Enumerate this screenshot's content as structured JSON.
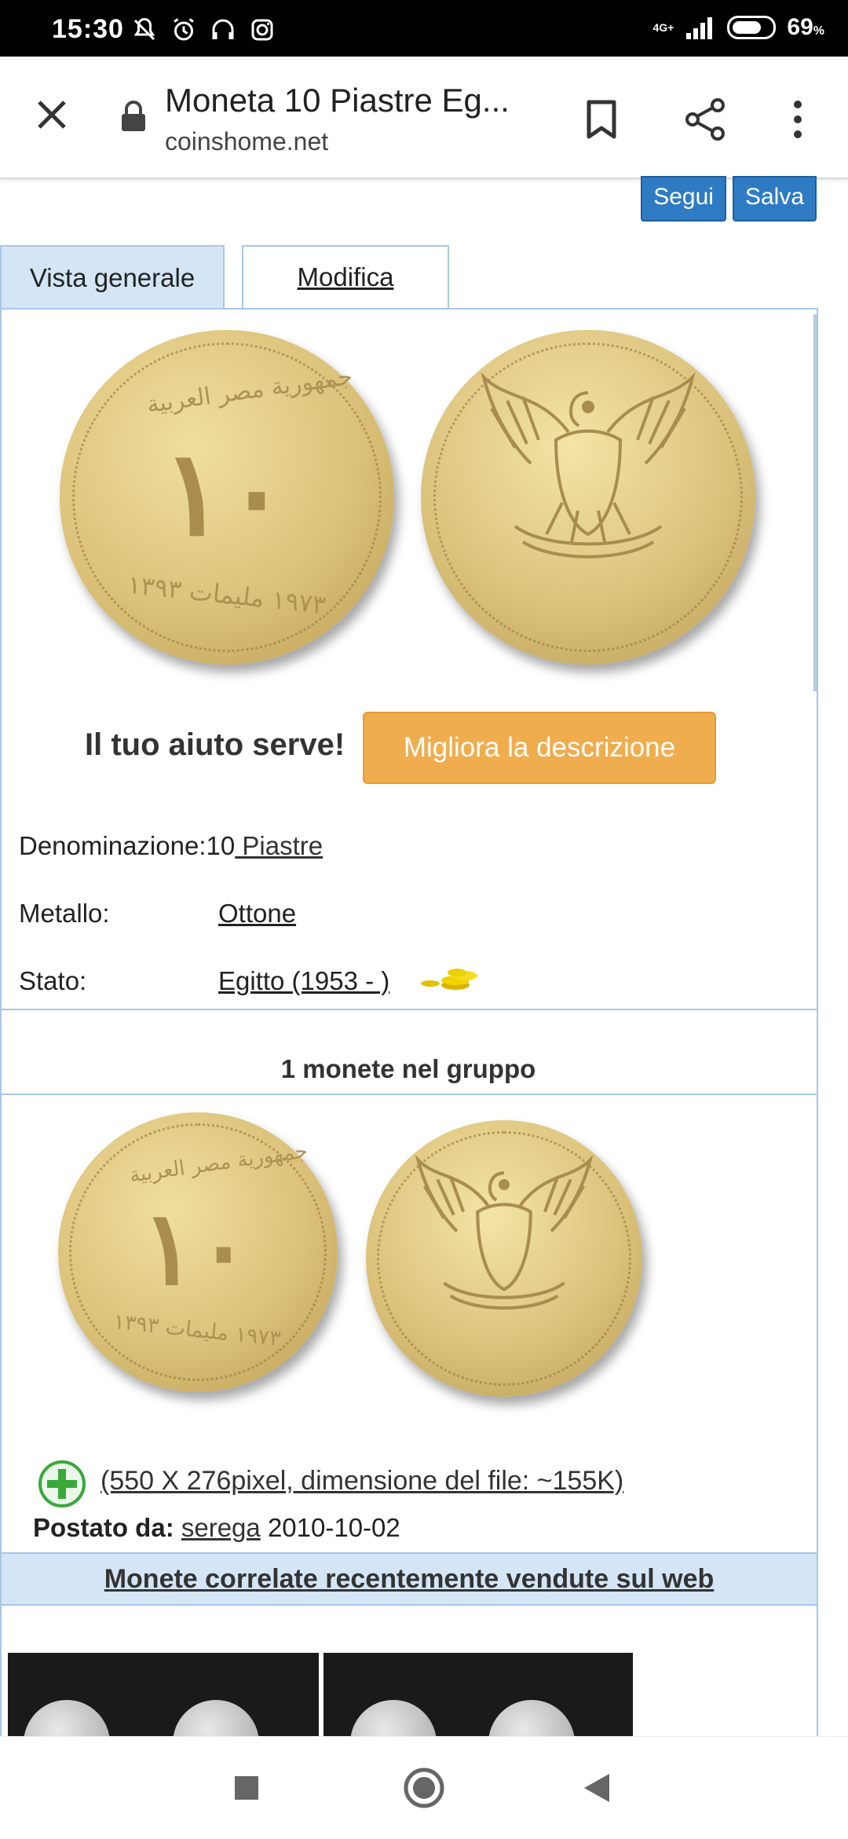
{
  "status_bar": {
    "time": "15:30",
    "network": "4G+",
    "battery": "69",
    "battery_unit": "%",
    "icons": [
      "mute-bell-icon",
      "alarm-icon",
      "headphones-icon",
      "instagram-icon",
      "signal-icon",
      "battery-icon"
    ]
  },
  "browser": {
    "page_title": "Moneta 10 Piastre Eg...",
    "host": "coinshome.net",
    "icons": [
      "close-icon",
      "lock-icon",
      "bookmark-icon",
      "share-icon",
      "more-vert-icon"
    ]
  },
  "actions": {
    "follow": "Segui",
    "save": "Salva"
  },
  "tabs": [
    {
      "label": "Vista generale",
      "active": true
    },
    {
      "label": "Modifica",
      "active": false
    }
  ],
  "coin_main": {
    "obverse_numeral": "١٠",
    "obverse_text_top": "جمهورية مصر العربية",
    "obverse_text_bottom": "١٩٧٣ مليمات ١٣٩٣"
  },
  "help": {
    "text": "Il tuo aiuto serve!",
    "button": "Migliora la descrizione"
  },
  "info": {
    "denomination_label": "Denominazione:",
    "denomination_value": "10",
    "denomination_link": " Piastre",
    "metal_label": "Metallo:",
    "metal_value": "Ottone",
    "state_label": "Stato:",
    "state_value": "Egitto (1953 - )"
  },
  "group": {
    "title": "1 monete nel gruppo",
    "file_info": "(550 X 276pixel, dimensione del file: ~155K)",
    "posted_label": "Postato da:",
    "posted_user": "serega",
    "posted_date": "2010-10-02"
  },
  "related": {
    "title": "Monete correlate recentemente vendute sul web"
  },
  "navbar": {
    "icons": [
      "recents-square-icon",
      "home-circle-icon",
      "back-triangle-icon"
    ]
  },
  "colors": {
    "tab_active": "#d4e5f6",
    "border": "#a9c6e6",
    "follow_button": "#2e7bc4",
    "help_button": "#f0ad4e"
  }
}
